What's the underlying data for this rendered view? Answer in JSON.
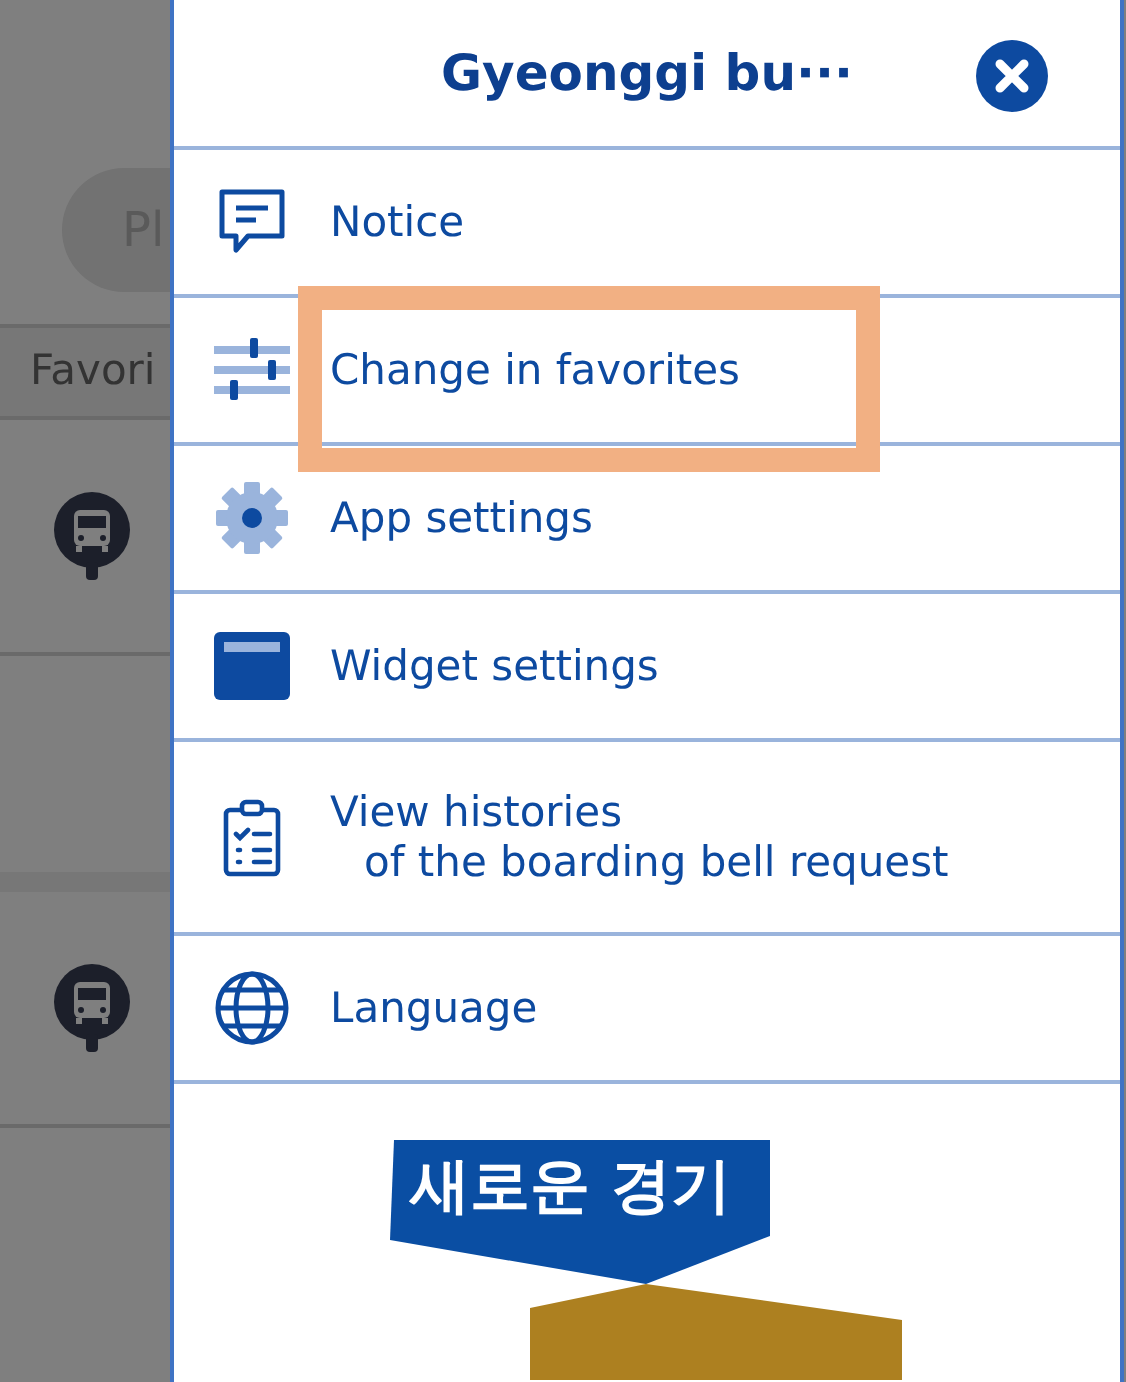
{
  "background": {
    "search": {
      "placeholder": "Pl"
    },
    "tab": {
      "label": "Favori"
    }
  },
  "drawer": {
    "title": "Gyeonggi bu···",
    "items": [
      {
        "kind": "notice",
        "lines": [
          "Notice"
        ],
        "highlighted": false
      },
      {
        "kind": "sliders",
        "lines": [
          "Change in favorites"
        ],
        "highlighted": true
      },
      {
        "kind": "gear",
        "lines": [
          "App settings"
        ],
        "highlighted": false
      },
      {
        "kind": "widget",
        "lines": [
          "Widget settings"
        ],
        "highlighted": false
      },
      {
        "kind": "clipboard",
        "lines": [
          "View histories",
          "of the boarding bell request"
        ],
        "highlighted": false
      },
      {
        "kind": "globe",
        "lines": [
          "Language"
        ],
        "highlighted": false
      }
    ],
    "banner": {
      "slogan": "새로운 경기"
    }
  }
}
